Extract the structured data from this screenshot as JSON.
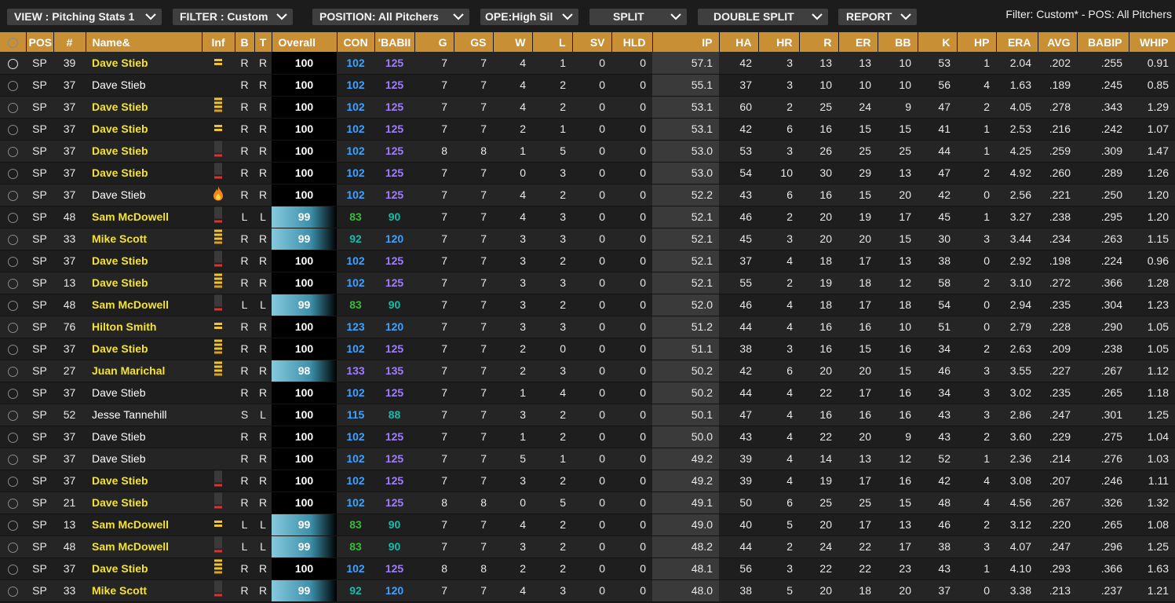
{
  "toolbar": {
    "view": "VIEW : Pitching Stats 1",
    "filter": "FILTER : Custom",
    "position": "POSITION: All Pitchers",
    "scope": "OPE:High Sil",
    "split": "SPLIT",
    "double_split": "DOUBLE SPLIT",
    "report": "REPORT",
    "status": "Filter: Custom* - POS: All Pitchers"
  },
  "colors": {
    "header_bg": "#c88f35",
    "name_highlight": "#f2e23a",
    "con_blue": "#3fa2ff",
    "babip_purple": "#a07cff",
    "rating_green": "#3cb83a",
    "rating_teal": "#20b8a8"
  },
  "columns": [
    "",
    "POS",
    "#",
    "Name&",
    "Inf",
    "B",
    "T",
    "Overall",
    "CON",
    "'BABII",
    "G",
    "GS",
    "W",
    "L",
    "SV",
    "HLD",
    "IP",
    "HA",
    "HR",
    "R",
    "ER",
    "BB",
    "K",
    "HP",
    "ERA",
    "AVG",
    "BABIP",
    "WHIP"
  ],
  "rows": [
    {
      "pos": "SP",
      "num": "39",
      "name": "Dave Stieb",
      "hl": true,
      "inf": "yellow-pair",
      "b": "R",
      "t": "R",
      "ovr": 100,
      "con": "102",
      "con_c": "blue",
      "bab": "125",
      "bab_c": "purple",
      "g": "7",
      "gs": "7",
      "w": "4",
      "l": "1",
      "sv": "0",
      "hld": "0",
      "ip": "57.1",
      "ha": "42",
      "hr": "3",
      "r": "13",
      "er": "13",
      "bb": "10",
      "k": "53",
      "hp": "1",
      "era": "2.04",
      "avg": ".202",
      "babip": ".255",
      "whip": "0.91",
      "sel": true
    },
    {
      "pos": "SP",
      "num": "37",
      "name": "Dave Stieb",
      "hl": false,
      "inf": "",
      "b": "R",
      "t": "R",
      "ovr": 100,
      "con": "102",
      "con_c": "blue",
      "bab": "125",
      "bab_c": "purple",
      "g": "7",
      "gs": "7",
      "w": "4",
      "l": "2",
      "sv": "0",
      "hld": "0",
      "ip": "55.1",
      "ha": "37",
      "hr": "3",
      "r": "10",
      "er": "10",
      "bb": "10",
      "k": "56",
      "hp": "4",
      "era": "1.63",
      "avg": ".189",
      "babip": ".245",
      "whip": "0.85"
    },
    {
      "pos": "SP",
      "num": "37",
      "name": "Dave Stieb",
      "hl": true,
      "inf": "yellow-stack",
      "b": "R",
      "t": "R",
      "ovr": 100,
      "con": "102",
      "con_c": "blue",
      "bab": "125",
      "bab_c": "purple",
      "g": "7",
      "gs": "7",
      "w": "4",
      "l": "2",
      "sv": "0",
      "hld": "0",
      "ip": "53.1",
      "ha": "60",
      "hr": "2",
      "r": "25",
      "er": "24",
      "bb": "9",
      "k": "47",
      "hp": "2",
      "era": "4.05",
      "avg": ".278",
      "babip": ".343",
      "whip": "1.29"
    },
    {
      "pos": "SP",
      "num": "37",
      "name": "Dave Stieb",
      "hl": true,
      "inf": "yellow-pair",
      "b": "R",
      "t": "R",
      "ovr": 100,
      "con": "102",
      "con_c": "blue",
      "bab": "125",
      "bab_c": "purple",
      "g": "7",
      "gs": "7",
      "w": "2",
      "l": "1",
      "sv": "0",
      "hld": "0",
      "ip": "53.1",
      "ha": "42",
      "hr": "6",
      "r": "16",
      "er": "15",
      "bb": "15",
      "k": "41",
      "hp": "1",
      "era": "2.53",
      "avg": ".216",
      "babip": ".242",
      "whip": "1.07"
    },
    {
      "pos": "SP",
      "num": "37",
      "name": "Dave Stieb",
      "hl": true,
      "inf": "red-bar",
      "b": "R",
      "t": "R",
      "ovr": 100,
      "con": "102",
      "con_c": "blue",
      "bab": "125",
      "bab_c": "purple",
      "g": "8",
      "gs": "8",
      "w": "1",
      "l": "5",
      "sv": "0",
      "hld": "0",
      "ip": "53.0",
      "ha": "53",
      "hr": "3",
      "r": "26",
      "er": "25",
      "bb": "25",
      "k": "44",
      "hp": "1",
      "era": "4.25",
      "avg": ".259",
      "babip": ".309",
      "whip": "1.47"
    },
    {
      "pos": "SP",
      "num": "37",
      "name": "Dave Stieb",
      "hl": true,
      "inf": "red-bar",
      "b": "R",
      "t": "R",
      "ovr": 100,
      "con": "102",
      "con_c": "blue",
      "bab": "125",
      "bab_c": "purple",
      "g": "7",
      "gs": "7",
      "w": "0",
      "l": "3",
      "sv": "0",
      "hld": "0",
      "ip": "53.0",
      "ha": "54",
      "hr": "10",
      "r": "30",
      "er": "29",
      "bb": "13",
      "k": "47",
      "hp": "2",
      "era": "4.92",
      "avg": ".260",
      "babip": ".289",
      "whip": "1.26"
    },
    {
      "pos": "SP",
      "num": "37",
      "name": "Dave Stieb",
      "hl": false,
      "inf": "fire",
      "b": "R",
      "t": "R",
      "ovr": 100,
      "con": "102",
      "con_c": "blue",
      "bab": "125",
      "bab_c": "purple",
      "g": "7",
      "gs": "7",
      "w": "4",
      "l": "2",
      "sv": "0",
      "hld": "0",
      "ip": "52.2",
      "ha": "43",
      "hr": "6",
      "r": "16",
      "er": "15",
      "bb": "20",
      "k": "42",
      "hp": "0",
      "era": "2.56",
      "avg": ".221",
      "babip": ".250",
      "whip": "1.20"
    },
    {
      "pos": "SP",
      "num": "48",
      "name": "Sam McDowell",
      "hl": true,
      "inf": "red-bar",
      "b": "L",
      "t": "L",
      "ovr": 99,
      "con": "83",
      "con_c": "green",
      "bab": "90",
      "bab_c": "teal",
      "g": "7",
      "gs": "7",
      "w": "4",
      "l": "3",
      "sv": "0",
      "hld": "0",
      "ip": "52.1",
      "ha": "46",
      "hr": "2",
      "r": "20",
      "er": "19",
      "bb": "17",
      "k": "45",
      "hp": "1",
      "era": "3.27",
      "avg": ".238",
      "babip": ".295",
      "whip": "1.20"
    },
    {
      "pos": "SP",
      "num": "33",
      "name": "Mike Scott",
      "hl": true,
      "inf": "yellow-stack",
      "b": "R",
      "t": "R",
      "ovr": 99,
      "con": "92",
      "con_c": "teal",
      "bab": "120",
      "bab_c": "blue",
      "g": "7",
      "gs": "7",
      "w": "3",
      "l": "3",
      "sv": "0",
      "hld": "0",
      "ip": "52.1",
      "ha": "45",
      "hr": "3",
      "r": "20",
      "er": "20",
      "bb": "15",
      "k": "30",
      "hp": "3",
      "era": "3.44",
      "avg": ".234",
      "babip": ".263",
      "whip": "1.15"
    },
    {
      "pos": "SP",
      "num": "37",
      "name": "Dave Stieb",
      "hl": true,
      "inf": "red-bar",
      "b": "R",
      "t": "R",
      "ovr": 100,
      "con": "102",
      "con_c": "blue",
      "bab": "125",
      "bab_c": "purple",
      "g": "7",
      "gs": "7",
      "w": "3",
      "l": "2",
      "sv": "0",
      "hld": "0",
      "ip": "52.1",
      "ha": "37",
      "hr": "4",
      "r": "18",
      "er": "17",
      "bb": "13",
      "k": "38",
      "hp": "0",
      "era": "2.92",
      "avg": ".198",
      "babip": ".224",
      "whip": "0.96"
    },
    {
      "pos": "SP",
      "num": "13",
      "name": "Dave Stieb",
      "hl": true,
      "inf": "yellow-stack",
      "b": "R",
      "t": "R",
      "ovr": 100,
      "con": "102",
      "con_c": "blue",
      "bab": "125",
      "bab_c": "purple",
      "g": "7",
      "gs": "7",
      "w": "3",
      "l": "3",
      "sv": "0",
      "hld": "0",
      "ip": "52.1",
      "ha": "55",
      "hr": "2",
      "r": "19",
      "er": "18",
      "bb": "12",
      "k": "58",
      "hp": "2",
      "era": "3.10",
      "avg": ".272",
      "babip": ".366",
      "whip": "1.28"
    },
    {
      "pos": "SP",
      "num": "48",
      "name": "Sam McDowell",
      "hl": true,
      "inf": "red-bar",
      "b": "L",
      "t": "L",
      "ovr": 99,
      "con": "83",
      "con_c": "green",
      "bab": "90",
      "bab_c": "teal",
      "g": "7",
      "gs": "7",
      "w": "3",
      "l": "2",
      "sv": "0",
      "hld": "0",
      "ip": "52.0",
      "ha": "46",
      "hr": "4",
      "r": "18",
      "er": "17",
      "bb": "18",
      "k": "54",
      "hp": "0",
      "era": "2.94",
      "avg": ".235",
      "babip": ".304",
      "whip": "1.23"
    },
    {
      "pos": "SP",
      "num": "76",
      "name": "Hilton Smith",
      "hl": true,
      "inf": "yellow-pair",
      "b": "R",
      "t": "R",
      "ovr": 100,
      "con": "123",
      "con_c": "blue",
      "bab": "120",
      "bab_c": "blue",
      "g": "7",
      "gs": "7",
      "w": "3",
      "l": "3",
      "sv": "0",
      "hld": "0",
      "ip": "51.2",
      "ha": "44",
      "hr": "4",
      "r": "16",
      "er": "16",
      "bb": "10",
      "k": "51",
      "hp": "0",
      "era": "2.79",
      "avg": ".228",
      "babip": ".290",
      "whip": "1.05"
    },
    {
      "pos": "SP",
      "num": "37",
      "name": "Dave Stieb",
      "hl": true,
      "inf": "yellow-stack",
      "b": "R",
      "t": "R",
      "ovr": 100,
      "con": "102",
      "con_c": "blue",
      "bab": "125",
      "bab_c": "purple",
      "g": "7",
      "gs": "7",
      "w": "2",
      "l": "0",
      "sv": "0",
      "hld": "0",
      "ip": "51.1",
      "ha": "38",
      "hr": "3",
      "r": "16",
      "er": "15",
      "bb": "16",
      "k": "34",
      "hp": "2",
      "era": "2.63",
      "avg": ".209",
      "babip": ".238",
      "whip": "1.05"
    },
    {
      "pos": "SP",
      "num": "27",
      "name": "Juan Marichal",
      "hl": true,
      "inf": "yellow-stack",
      "b": "R",
      "t": "R",
      "ovr": 98,
      "con": "133",
      "con_c": "purple",
      "bab": "135",
      "bab_c": "purple",
      "g": "7",
      "gs": "7",
      "w": "2",
      "l": "3",
      "sv": "0",
      "hld": "0",
      "ip": "50.2",
      "ha": "42",
      "hr": "6",
      "r": "20",
      "er": "20",
      "bb": "15",
      "k": "46",
      "hp": "3",
      "era": "3.55",
      "avg": ".227",
      "babip": ".267",
      "whip": "1.12"
    },
    {
      "pos": "SP",
      "num": "37",
      "name": "Dave Stieb",
      "hl": false,
      "inf": "",
      "b": "R",
      "t": "R",
      "ovr": 100,
      "con": "102",
      "con_c": "blue",
      "bab": "125",
      "bab_c": "purple",
      "g": "7",
      "gs": "7",
      "w": "1",
      "l": "4",
      "sv": "0",
      "hld": "0",
      "ip": "50.2",
      "ha": "44",
      "hr": "4",
      "r": "22",
      "er": "17",
      "bb": "16",
      "k": "34",
      "hp": "3",
      "era": "3.02",
      "avg": ".235",
      "babip": ".265",
      "whip": "1.18"
    },
    {
      "pos": "SP",
      "num": "52",
      "name": "Jesse Tannehill",
      "hl": false,
      "inf": "",
      "b": "S",
      "t": "L",
      "ovr": 100,
      "con": "115",
      "con_c": "blue",
      "bab": "88",
      "bab_c": "teal",
      "g": "7",
      "gs": "7",
      "w": "3",
      "l": "2",
      "sv": "0",
      "hld": "0",
      "ip": "50.1",
      "ha": "47",
      "hr": "4",
      "r": "16",
      "er": "16",
      "bb": "16",
      "k": "43",
      "hp": "3",
      "era": "2.86",
      "avg": ".247",
      "babip": ".301",
      "whip": "1.25"
    },
    {
      "pos": "SP",
      "num": "37",
      "name": "Dave Stieb",
      "hl": false,
      "inf": "",
      "b": "R",
      "t": "R",
      "ovr": 100,
      "con": "102",
      "con_c": "blue",
      "bab": "125",
      "bab_c": "purple",
      "g": "7",
      "gs": "7",
      "w": "1",
      "l": "2",
      "sv": "0",
      "hld": "0",
      "ip": "50.0",
      "ha": "43",
      "hr": "4",
      "r": "22",
      "er": "20",
      "bb": "9",
      "k": "43",
      "hp": "2",
      "era": "3.60",
      "avg": ".229",
      "babip": ".275",
      "whip": "1.04"
    },
    {
      "pos": "SP",
      "num": "37",
      "name": "Dave Stieb",
      "hl": false,
      "inf": "",
      "b": "R",
      "t": "R",
      "ovr": 100,
      "con": "102",
      "con_c": "blue",
      "bab": "125",
      "bab_c": "purple",
      "g": "7",
      "gs": "7",
      "w": "5",
      "l": "1",
      "sv": "0",
      "hld": "0",
      "ip": "49.2",
      "ha": "39",
      "hr": "4",
      "r": "14",
      "er": "13",
      "bb": "12",
      "k": "52",
      "hp": "1",
      "era": "2.36",
      "avg": ".214",
      "babip": ".276",
      "whip": "1.03"
    },
    {
      "pos": "SP",
      "num": "37",
      "name": "Dave Stieb",
      "hl": true,
      "inf": "red-bar",
      "b": "R",
      "t": "R",
      "ovr": 100,
      "con": "102",
      "con_c": "blue",
      "bab": "125",
      "bab_c": "purple",
      "g": "7",
      "gs": "7",
      "w": "3",
      "l": "2",
      "sv": "0",
      "hld": "0",
      "ip": "49.2",
      "ha": "39",
      "hr": "4",
      "r": "19",
      "er": "17",
      "bb": "16",
      "k": "42",
      "hp": "4",
      "era": "3.08",
      "avg": ".207",
      "babip": ".246",
      "whip": "1.11"
    },
    {
      "pos": "SP",
      "num": "21",
      "name": "Dave Stieb",
      "hl": true,
      "inf": "red-bar",
      "b": "R",
      "t": "R",
      "ovr": 100,
      "con": "102",
      "con_c": "blue",
      "bab": "125",
      "bab_c": "purple",
      "g": "8",
      "gs": "8",
      "w": "0",
      "l": "5",
      "sv": "0",
      "hld": "0",
      "ip": "49.1",
      "ha": "50",
      "hr": "6",
      "r": "25",
      "er": "25",
      "bb": "15",
      "k": "48",
      "hp": "4",
      "era": "4.56",
      "avg": ".267",
      "babip": ".326",
      "whip": "1.32"
    },
    {
      "pos": "SP",
      "num": "13",
      "name": "Sam McDowell",
      "hl": true,
      "inf": "yellow-pair",
      "b": "L",
      "t": "L",
      "ovr": 99,
      "con": "83",
      "con_c": "green",
      "bab": "90",
      "bab_c": "teal",
      "g": "7",
      "gs": "7",
      "w": "4",
      "l": "2",
      "sv": "0",
      "hld": "0",
      "ip": "49.0",
      "ha": "40",
      "hr": "5",
      "r": "20",
      "er": "17",
      "bb": "13",
      "k": "46",
      "hp": "2",
      "era": "3.12",
      "avg": ".220",
      "babip": ".265",
      "whip": "1.08"
    },
    {
      "pos": "SP",
      "num": "48",
      "name": "Sam McDowell",
      "hl": true,
      "inf": "red-bar",
      "b": "L",
      "t": "L",
      "ovr": 99,
      "con": "83",
      "con_c": "green",
      "bab": "90",
      "bab_c": "teal",
      "g": "7",
      "gs": "7",
      "w": "3",
      "l": "2",
      "sv": "0",
      "hld": "0",
      "ip": "48.2",
      "ha": "44",
      "hr": "2",
      "r": "24",
      "er": "22",
      "bb": "17",
      "k": "38",
      "hp": "3",
      "era": "4.07",
      "avg": ".247",
      "babip": ".296",
      "whip": "1.25"
    },
    {
      "pos": "SP",
      "num": "37",
      "name": "Dave Stieb",
      "hl": true,
      "inf": "yellow-stack",
      "b": "R",
      "t": "R",
      "ovr": 100,
      "con": "102",
      "con_c": "blue",
      "bab": "125",
      "bab_c": "purple",
      "g": "8",
      "gs": "8",
      "w": "2",
      "l": "2",
      "sv": "0",
      "hld": "0",
      "ip": "48.1",
      "ha": "56",
      "hr": "3",
      "r": "22",
      "er": "22",
      "bb": "23",
      "k": "43",
      "hp": "1",
      "era": "4.10",
      "avg": ".293",
      "babip": ".366",
      "whip": "1.63"
    },
    {
      "pos": "SP",
      "num": "33",
      "name": "Mike Scott",
      "hl": true,
      "inf": "red-bar",
      "b": "R",
      "t": "R",
      "ovr": 99,
      "con": "92",
      "con_c": "teal",
      "bab": "120",
      "bab_c": "blue",
      "g": "7",
      "gs": "7",
      "w": "4",
      "l": "3",
      "sv": "0",
      "hld": "0",
      "ip": "48.0",
      "ha": "38",
      "hr": "5",
      "r": "20",
      "er": "18",
      "bb": "20",
      "k": "37",
      "hp": "0",
      "era": "3.38",
      "avg": ".213",
      "babip": ".237",
      "whip": "1.21"
    }
  ]
}
